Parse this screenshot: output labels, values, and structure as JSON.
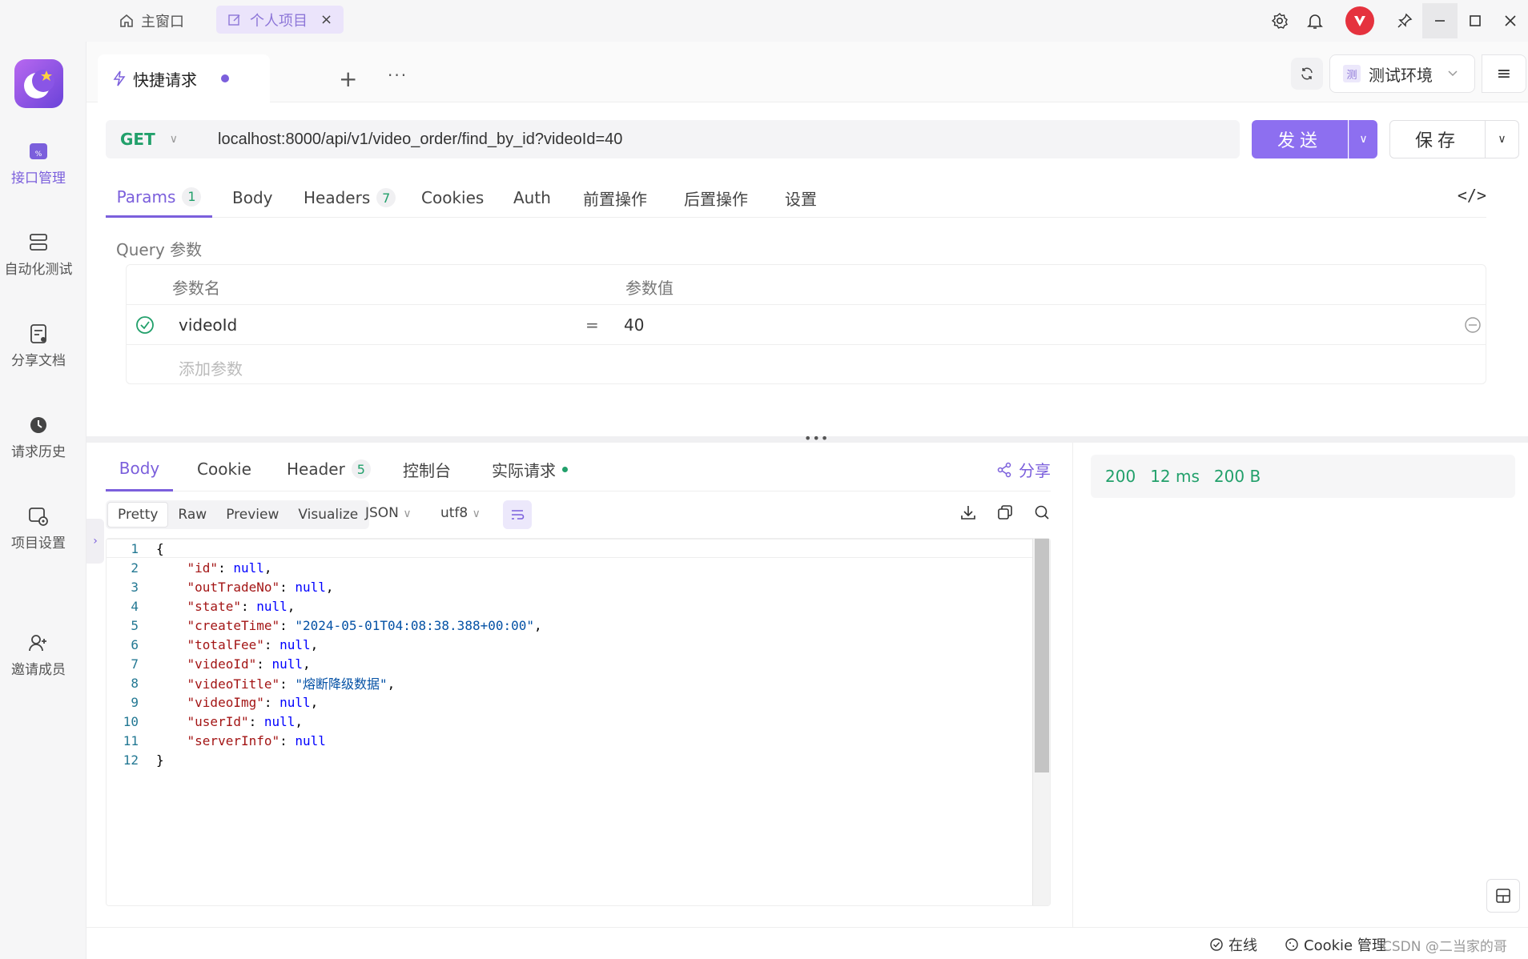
{
  "titlebar": {
    "home_tab": "主窗口",
    "project_tab": "个人项目",
    "close_glyph": "×"
  },
  "rail": {
    "items": [
      {
        "label": "接口管理",
        "icon": "api-icon"
      },
      {
        "label": "自动化测试",
        "icon": "automation-icon"
      },
      {
        "label": "分享文档",
        "icon": "share-doc-icon"
      },
      {
        "label": "请求历史",
        "icon": "history-icon"
      },
      {
        "label": "项目设置",
        "icon": "project-settings-icon"
      },
      {
        "label": "邀请成员",
        "icon": "invite-member-icon"
      }
    ]
  },
  "request_tab": {
    "title": "快捷请求"
  },
  "environment": {
    "badge": "测",
    "name": "测试环境"
  },
  "request": {
    "method": "GET",
    "url": "localhost:8000/api/v1/video_order/find_by_id?videoId=40",
    "send_label": "发送",
    "save_label": "保存"
  },
  "subtabs": [
    {
      "label": "Params",
      "count": "1"
    },
    {
      "label": "Body"
    },
    {
      "label": "Headers",
      "count": "7"
    },
    {
      "label": "Cookies"
    },
    {
      "label": "Auth"
    },
    {
      "label": "前置操作"
    },
    {
      "label": "后置操作"
    },
    {
      "label": "设置"
    }
  ],
  "params": {
    "title": "Query 参数",
    "name_header": "参数名",
    "value_header": "参数值",
    "rows": [
      {
        "name": "videoId",
        "eq": "=",
        "value": "40",
        "enabled": true
      }
    ],
    "add_placeholder": "添加参数"
  },
  "response_tabs": [
    {
      "label": "Body"
    },
    {
      "label": "Cookie"
    },
    {
      "label": "Header",
      "count": "5"
    },
    {
      "label": "控制台"
    },
    {
      "label": "实际请求"
    }
  ],
  "share_label": "分享",
  "format": {
    "modes": [
      "Pretty",
      "Raw",
      "Preview",
      "Visualize"
    ],
    "language": "JSON",
    "encoding": "utf8"
  },
  "response_body": {
    "lines": [
      {
        "n": "1",
        "html": "{"
      },
      {
        "n": "2",
        "key": "\"id\"",
        "val": "null",
        "kind": "lit",
        "end": ","
      },
      {
        "n": "3",
        "key": "\"outTradeNo\"",
        "val": "null",
        "kind": "lit",
        "end": ","
      },
      {
        "n": "4",
        "key": "\"state\"",
        "val": "null",
        "kind": "lit",
        "end": ","
      },
      {
        "n": "5",
        "key": "\"createTime\"",
        "val": "\"2024-05-01T04:08:38.388+00:00\"",
        "kind": "str",
        "end": ","
      },
      {
        "n": "6",
        "key": "\"totalFee\"",
        "val": "null",
        "kind": "lit",
        "end": ","
      },
      {
        "n": "7",
        "key": "\"videoId\"",
        "val": "null",
        "kind": "lit",
        "end": ","
      },
      {
        "n": "8",
        "key": "\"videoTitle\"",
        "val": "\"熔断降级数据\"",
        "kind": "str",
        "end": ","
      },
      {
        "n": "9",
        "key": "\"videoImg\"",
        "val": "null",
        "kind": "lit",
        "end": ","
      },
      {
        "n": "10",
        "key": "\"userId\"",
        "val": "null",
        "kind": "lit",
        "end": ","
      },
      {
        "n": "11",
        "key": "\"serverInfo\"",
        "val": "null",
        "kind": "lit",
        "end": ""
      },
      {
        "n": "12",
        "html": "}"
      }
    ]
  },
  "response_meta": {
    "status": "200",
    "time": "12 ms",
    "size": "200 B"
  },
  "statusbar": {
    "online": "在线",
    "cookie": "Cookie 管理",
    "watermark": "CSDN @二当家的哥"
  },
  "colors": {
    "accent": "#7b5fdc",
    "send": "#8d6ff0",
    "success": "#22a06b"
  }
}
